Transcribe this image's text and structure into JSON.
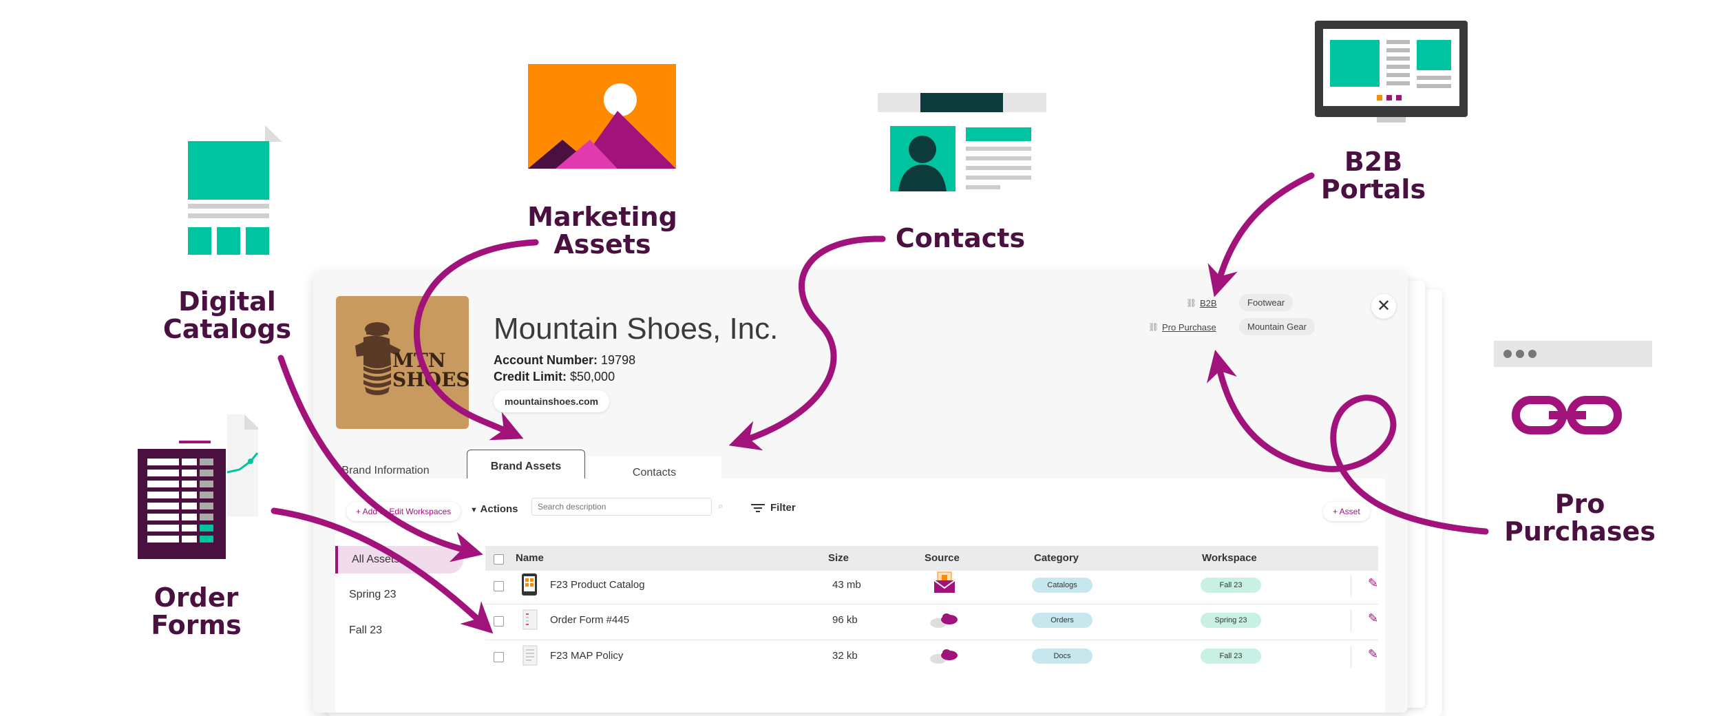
{
  "callouts": {
    "digital_catalogs": [
      "Digital",
      "Catalogs"
    ],
    "marketing_assets": [
      "Marketing",
      "Assets"
    ],
    "contacts": "Contacts",
    "b2b_portals": [
      "B2B",
      "Portals"
    ],
    "order_forms": [
      "Order",
      "Forms"
    ],
    "pro_purchases": [
      "Pro",
      "Purchases"
    ]
  },
  "colors": {
    "brand_purple": "#a1127b",
    "dark_purple": "#4a1040",
    "teal": "#00c4a0",
    "orange": "#ff8a00"
  },
  "profile": {
    "logo_text": [
      "MTN",
      "SHOES"
    ],
    "company_name": "Mountain Shoes, Inc.",
    "account_label": "Account Number:",
    "account_value": "19798",
    "credit_label": "Credit Limit:",
    "credit_value": "$50,000",
    "website": "mountainshoes.com",
    "links": [
      "B2B",
      "Pro Purchase"
    ],
    "tags": [
      "Footwear",
      "Mountain Gear"
    ]
  },
  "tabs": [
    "Brand Information",
    "Brand Assets",
    "Contacts"
  ],
  "toolbar": {
    "workspaces_button": "+ Add or Edit Workspaces",
    "actions": "Actions",
    "search_placeholder": "Search description",
    "filter": "Filter",
    "add_asset": "+ Asset"
  },
  "sidebar": [
    "All Assets",
    "Spring  23",
    "Fall 23"
  ],
  "table": {
    "headers": [
      "Name",
      "Size",
      "Source",
      "Category",
      "Workspace"
    ],
    "rows": [
      {
        "name": "F23 Product Catalog",
        "size": "43 mb",
        "category": "Catalogs",
        "workspace": "Fall 23",
        "icon": "tablet-icon",
        "source_icon": "mail-icon"
      },
      {
        "name": "Order Form #445",
        "size": "96 kb",
        "category": "Orders",
        "workspace": "Spring 23",
        "icon": "document-icon",
        "source_icon": "cloud-icon"
      },
      {
        "name": "F23 MAP Policy",
        "size": "32 kb",
        "category": "Docs",
        "workspace": "Fall 23",
        "icon": "document-icon",
        "source_icon": "cloud-icon"
      }
    ]
  }
}
